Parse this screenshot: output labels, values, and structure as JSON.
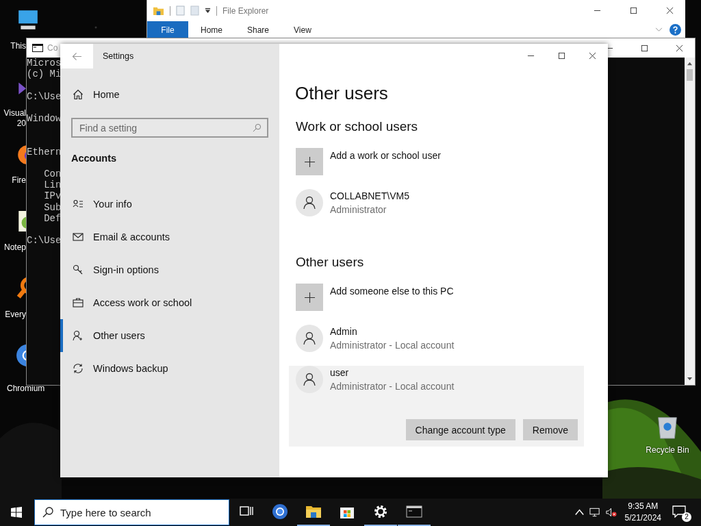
{
  "desktop": {
    "icons": [
      {
        "kind": "monitor",
        "label": "This"
      },
      {
        "kind": "vs",
        "label": "Visual 20"
      },
      {
        "kind": "firefox",
        "label": "Fire"
      },
      {
        "kind": "notepad",
        "label": "Notep"
      },
      {
        "kind": "everything",
        "label": "Every"
      },
      {
        "kind": "chromium",
        "label": "Chromium"
      }
    ],
    "recycle_bin": {
      "label": "Recycle Bin"
    }
  },
  "file_explorer": {
    "title": "File Explorer",
    "ribbon_tabs": [
      {
        "label": "File",
        "selected": true
      },
      {
        "label": "Home",
        "selected": false
      },
      {
        "label": "Share",
        "selected": false
      },
      {
        "label": "View",
        "selected": false
      }
    ]
  },
  "command_prompt": {
    "title": "Co",
    "blocks": [
      [
        "Micros",
        "(c) Mi"
      ],
      [
        "C:\\Use"
      ],
      [
        "Window"
      ],
      [
        "Ethern"
      ],
      [
        "   Con",
        "   Lin",
        "   IPv",
        "   Sub",
        "   Def"
      ],
      [
        "C:\\Use"
      ]
    ]
  },
  "settings": {
    "title": "Settings",
    "home": "Home",
    "search": {
      "placeholder": "Find a setting"
    },
    "section": "Accounts",
    "nav_items": [
      {
        "kind": "info",
        "label": "Your info",
        "selected": false
      },
      {
        "kind": "email",
        "label": "Email & accounts",
        "selected": false
      },
      {
        "kind": "key",
        "label": "Sign-in options",
        "selected": false
      },
      {
        "kind": "briefcase",
        "label": "Access work or school",
        "selected": false
      },
      {
        "kind": "person-add",
        "label": "Other users",
        "selected": true
      },
      {
        "kind": "sync",
        "label": "Windows backup",
        "selected": false
      }
    ],
    "heading": "Other users",
    "groups": [
      {
        "title": "Work or school users",
        "add_label": "Add a work or school user",
        "users": [
          {
            "name": "COLLABNET\\VM5",
            "role": "Administrator",
            "expanded": false
          }
        ]
      },
      {
        "title": "Other users",
        "add_label": "Add someone else to this PC",
        "users": [
          {
            "name": "Admin",
            "role": "Administrator - Local account",
            "expanded": false
          },
          {
            "name": "user",
            "role": "Administrator - Local account",
            "expanded": true
          }
        ]
      }
    ],
    "buttons": [
      "Change account type",
      "Remove"
    ]
  },
  "taskbar": {
    "search_placeholder": "Type here to search",
    "apps": [
      {
        "kind": "task-view",
        "running": false
      },
      {
        "kind": "chromium",
        "running": false
      },
      {
        "kind": "folder",
        "running": true
      },
      {
        "kind": "store",
        "running": false
      },
      {
        "kind": "gear",
        "running": true
      },
      {
        "kind": "terminal",
        "running": true
      }
    ],
    "time": "9:35 AM",
    "date": "5/21/2024",
    "notifications": "2"
  }
}
